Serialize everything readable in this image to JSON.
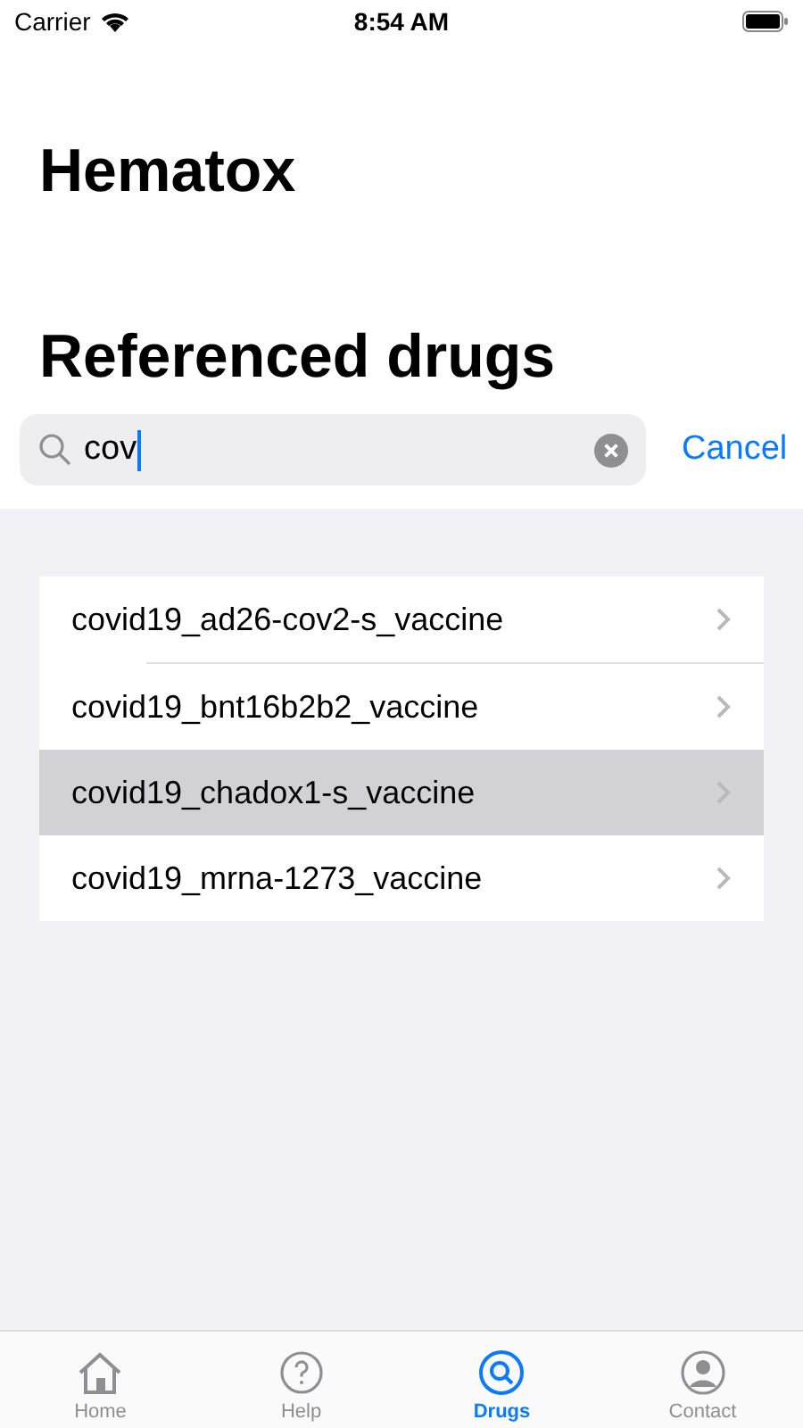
{
  "status_bar": {
    "carrier": "Carrier",
    "time": "8:54 AM"
  },
  "app_title": "Hematox",
  "section_title": "Referenced drugs",
  "search": {
    "value": "cov",
    "cancel": "Cancel"
  },
  "results": [
    {
      "label": "covid19_ad26-cov2-s_vaccine",
      "selected": false
    },
    {
      "label": "covid19_bnt16b2b2_vaccine",
      "selected": false
    },
    {
      "label": "covid19_chadox1-s_vaccine",
      "selected": true
    },
    {
      "label": "covid19_mrna-1273_vaccine",
      "selected": false
    }
  ],
  "tabs": [
    {
      "label": "Home",
      "kind": "home",
      "selected": false
    },
    {
      "label": "Help",
      "kind": "help",
      "selected": false
    },
    {
      "label": "Drugs",
      "kind": "search",
      "selected": true
    },
    {
      "label": "Contact",
      "kind": "person",
      "selected": false
    }
  ]
}
